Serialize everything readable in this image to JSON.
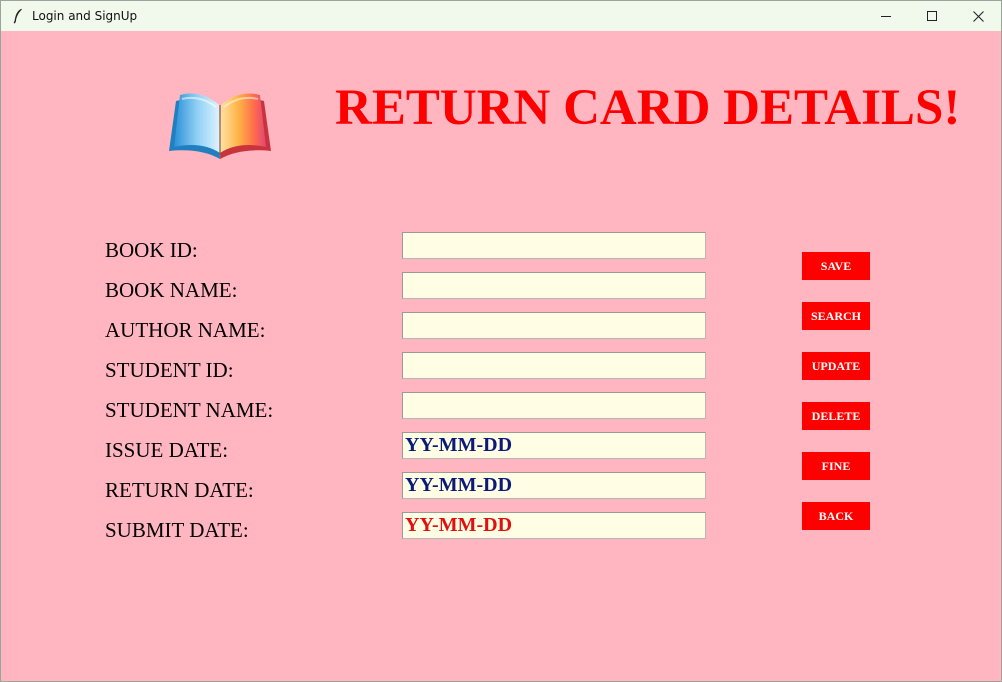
{
  "window": {
    "title": "Login and SignUp",
    "icon": "feather-icon"
  },
  "header": {
    "logo_icon": "open-book-icon",
    "title": "RETURN CARD DETAILS!"
  },
  "form": {
    "fields": [
      {
        "label": "BOOK ID:",
        "value": ""
      },
      {
        "label": "BOOK NAME:",
        "value": ""
      },
      {
        "label": "AUTHOR NAME:",
        "value": ""
      },
      {
        "label": "STUDENT ID:",
        "value": ""
      },
      {
        "label": "STUDENT NAME:",
        "value": ""
      },
      {
        "label": "ISSUE DATE:",
        "value": "YY-MM-DD"
      },
      {
        "label": "RETURN DATE:",
        "value": "YY-MM-DD"
      },
      {
        "label": "SUBMIT DATE:",
        "value": "YY-MM-DD"
      }
    ]
  },
  "actions": {
    "save": "SAVE",
    "search": "SEARCH",
    "update": "UPDATE",
    "delete": "DELETE",
    "fine": "FINE",
    "back": "BACK"
  },
  "colors": {
    "background": "#ffb6c1",
    "title": "#ff0000",
    "button_bg": "#ff0000",
    "button_text": "#ffffff",
    "input_bg": "#fffee4",
    "date_blue": "#0a1a7a",
    "date_red": "#e01010"
  }
}
